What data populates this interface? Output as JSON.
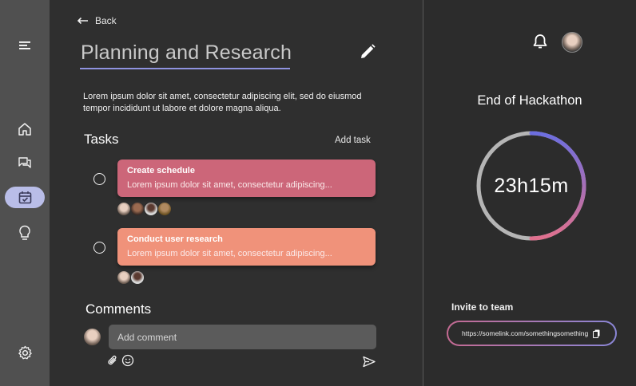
{
  "nav": {
    "back_label": "Back"
  },
  "project": {
    "title": "Planning and Research",
    "description": "Lorem ipsum dolor sit amet, consectetur adipiscing elit, sed do eiusmod tempor incididunt ut labore et dolore magna aliqua."
  },
  "tasks": {
    "heading": "Tasks",
    "add_label": "Add task",
    "items": [
      {
        "title": "Create schedule",
        "description": "Lorem ipsum dolor sit amet, consectetur adipiscing...",
        "color": "#cc6679"
      },
      {
        "title": "Conduct user research",
        "description": "Lorem ipsum dolor sit amet, consectetur adipiscing...",
        "color": "#f0927a"
      }
    ]
  },
  "comments": {
    "heading": "Comments",
    "input_placeholder": "Add comment"
  },
  "countdown": {
    "heading": "End of Hackathon",
    "time": "23h15m"
  },
  "invite": {
    "heading": "Invite to team",
    "link": "https://somelink.com/somethingsomething"
  },
  "colors": {
    "accent": "#8f93e0",
    "sidebar_active": "#b9bde8",
    "ring_gradient_start": "#e0708e",
    "ring_gradient_end": "#6c6ee0"
  }
}
